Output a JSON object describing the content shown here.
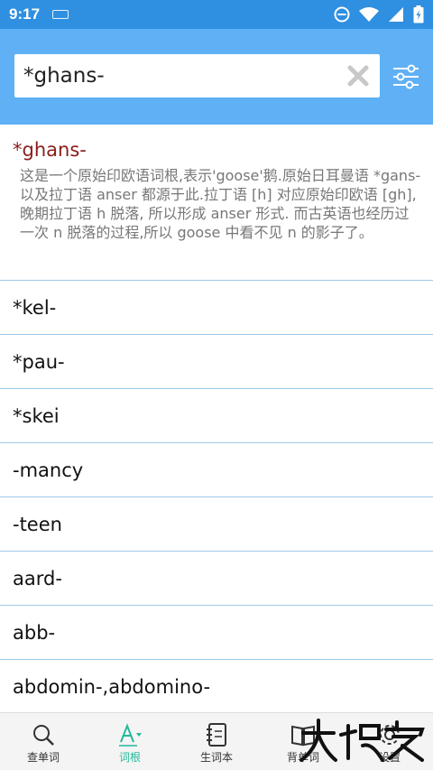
{
  "status_bar": {
    "time": "9:17"
  },
  "search": {
    "value": "*ghans-",
    "placeholder": ""
  },
  "detail": {
    "title": "*ghans-",
    "description": "这是一个原始印欧语词根,表示'goose'鹅.原始日耳曼语 *gans- 以及拉丁语 anser 都源于此.拉丁语 [h] 对应原始印欧语 [gh], 晚期拉丁语 h 脱落, 所以形成 anser 形式. 而古英语也经历过一次 n 脱落的过程,所以 goose 中看不见 n 的影子了。"
  },
  "list": [
    "*kel-",
    "*pau-",
    "*skei",
    "-mancy",
    "-teen",
    "aard-",
    "abb-",
    "abdomin-,abdomino-"
  ],
  "tabs": [
    {
      "label": "查单词",
      "icon": "search-icon"
    },
    {
      "label": "词根",
      "icon": "font-icon",
      "active": true
    },
    {
      "label": "生词本",
      "icon": "notebook-icon"
    },
    {
      "label": "背单词",
      "icon": "book-icon"
    },
    {
      "label": "设置",
      "icon": "gear-icon"
    }
  ],
  "colors": {
    "header": "#5fb0f4",
    "status": "#2f8fe0",
    "accent": "#25b89a",
    "title": "#8a1c1c"
  }
}
